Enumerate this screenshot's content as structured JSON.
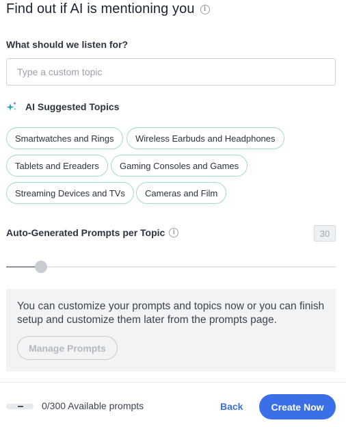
{
  "header": {
    "title": "Find out if AI is mentioning you",
    "info_icon": "i"
  },
  "listen": {
    "label": "What should we listen for?",
    "placeholder": "Type a custom topic",
    "value": ""
  },
  "suggested": {
    "icon": "sparkle-icon",
    "label": "AI Suggested Topics",
    "chips": [
      "Smartwatches and Rings",
      "Wireless Earbuds and Headphones",
      "Tablets and Ereaders",
      "Gaming Consoles and Games",
      "Streaming Devices and TVs",
      "Cameras and Film"
    ]
  },
  "prompts_slider": {
    "label": "Auto-Generated Prompts per Topic",
    "info_icon": "i",
    "value": "30"
  },
  "info_panel": {
    "text": "You can customize your prompts and topics now or you can finish setup and customize them later from the prompts page.",
    "button_label": "Manage Prompts"
  },
  "footer": {
    "available_text": "0/300 Available prompts",
    "back_label": "Back",
    "create_label": "Create Now"
  },
  "colors": {
    "accent": "#3b6fe8",
    "chip_border": "#9fdcc9",
    "panel_bg": "#f2f3f5"
  }
}
